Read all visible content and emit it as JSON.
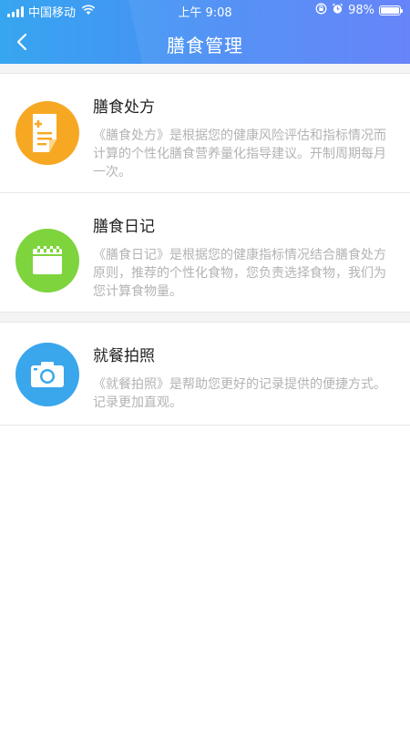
{
  "status_bar": {
    "carrier": "中国移动",
    "time": "上午 9:08",
    "battery": "98%",
    "battery_level": 0.98
  },
  "nav": {
    "title": "膳食管理",
    "back_icon": "chevron-left-icon"
  },
  "items": [
    {
      "title": "膳食处方",
      "desc": "《膳食处方》是根据您的健康风险评估和指标情况而计算的个性化膳食营养量化指导建议。开制周期每月一次。",
      "icon": "prescription-document-icon",
      "color": "#f7a823"
    },
    {
      "title": "膳食日记",
      "desc": "《膳食日记》是根据您的健康指标情况结合膳食处方原则，推荐的个性化食物，您负责选择食物，我们为您计算食物量。",
      "icon": "calendar-icon",
      "color": "#7ed43d"
    },
    {
      "title": "就餐拍照",
      "desc": "《就餐拍照》是帮助您更好的记录提供的便捷方式。记录更加直观。",
      "icon": "camera-icon",
      "color": "#3aa6ec"
    }
  ]
}
